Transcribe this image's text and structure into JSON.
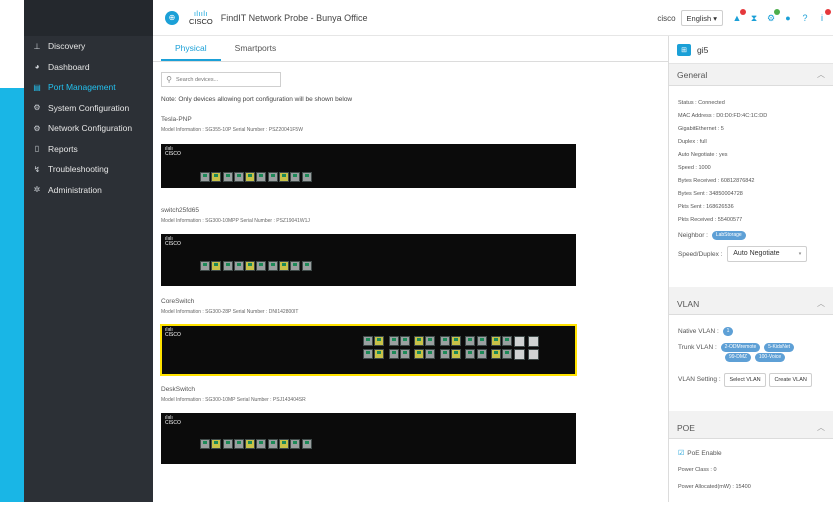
{
  "app": {
    "title": "FindIT Network Probe  -  Bunya Office",
    "brand_bars": "ılıılı",
    "brand_word": "CISCO",
    "user": "cisco",
    "language": "English ▾",
    "brand_color": "#1ba0d7"
  },
  "sidebar": {
    "items": [
      {
        "label": "Discovery",
        "icon": "discovery-icon",
        "glyph": "⊥"
      },
      {
        "label": "Dashboard",
        "icon": "dashboard-icon",
        "glyph": "◕"
      },
      {
        "label": "Port Management",
        "icon": "port-management-icon",
        "glyph": "▤"
      },
      {
        "label": "System Configuration",
        "icon": "system-configuration-icon",
        "glyph": "⚙"
      },
      {
        "label": "Network Configuration",
        "icon": "network-configuration-icon",
        "glyph": "⚙"
      },
      {
        "label": "Reports",
        "icon": "reports-icon",
        "glyph": "▯"
      },
      {
        "label": "Troubleshooting",
        "icon": "troubleshooting-icon",
        "glyph": "↯"
      },
      {
        "label": "Administration",
        "icon": "administration-icon",
        "glyph": "✲"
      }
    ],
    "active_index": 2
  },
  "topbar_icons": [
    "alert-icon",
    "hourglass-icon",
    "gear-icon",
    "chat-icon",
    "help-icon",
    "info-icon"
  ],
  "tabs": [
    {
      "label": "Physical",
      "active": true
    },
    {
      "label": "Smartports",
      "active": false
    }
  ],
  "search": {
    "placeholder": "Search devices..."
  },
  "note": "Note: Only devices allowing port configuration will be shown below",
  "devices": [
    {
      "name": "Tesla-PNP",
      "info": "Model Information : SG355-10P   Serial Number : PSZ20041F5W"
    },
    {
      "name": "switch25fd65",
      "info": "Model Information : SG300-10MPP   Serial Number : PSZ19041W1J"
    },
    {
      "name": "CoreSwitch",
      "info": "Model Information : SG300-28P   Serial Number : DNI142800IT"
    },
    {
      "name": "DeskSwitch",
      "info": "Model Information : SG300-10MP   Serial Number : PSJ143404SR"
    }
  ],
  "panel": {
    "port": "gi5",
    "general": {
      "title": "General",
      "status": "Status : Connected",
      "mac": "MAC Address : D0:D0:FD:4C:1C:DD",
      "gig": "GigabitEthernet : 5",
      "duplex": "Duplex : full",
      "autoneg": "Auto Negotiate : yes",
      "speed": "Speed : 1000",
      "bytes_received": "Bytes Received : 60812876842",
      "bytes_sent": "Bytes Sent : 34850004728",
      "pkts_sent": "Pkts Sent : 168626536",
      "pkts_received": "Pkts Received : 55400577",
      "neighbor_label": "Neighbor :",
      "neighbor_value": "LabStorage",
      "speed_duplex_label": "Speed/Duplex :",
      "speed_duplex_value": "Auto Negotiate"
    },
    "vlan": {
      "title": "VLAN",
      "native_label": "Native VLAN :",
      "native_value": "1",
      "trunk_label": "Trunk VLAN :",
      "trunk_values": [
        "2-ODMremote",
        "5-KidsNet",
        "99-DMZ",
        "100-Voice"
      ],
      "setting_label": "VLAN Setting :",
      "select_btn": "Select VLAN",
      "create_btn": "Create VLAN"
    },
    "poe": {
      "title": "POE",
      "enable": "PoE Enable",
      "power_class": "Power Class : 0",
      "power_alloc": "Power Allocated(mW) : 15400"
    }
  }
}
